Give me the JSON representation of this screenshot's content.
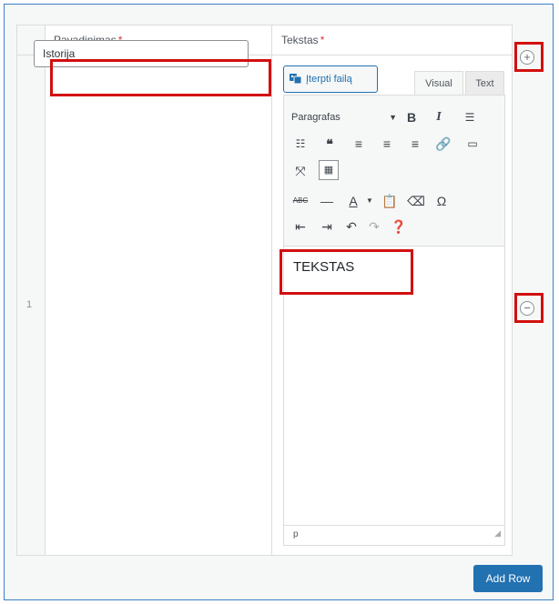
{
  "columns": {
    "title_label": "Pavadinimas",
    "text_label": "Tekstas",
    "required_mark": "*"
  },
  "row": {
    "index": "1",
    "title_value": "Istorija"
  },
  "editor": {
    "add_media_label": "Įterpti failą",
    "tabs": {
      "visual": "Visual",
      "text": "Text"
    },
    "format_select": "Paragrafas",
    "content": "TEKSTAS",
    "status_path": "p"
  },
  "actions": {
    "add_row_label": "Add Row"
  },
  "icons": {
    "add_row_inline": "plus-circle-icon",
    "remove_row": "minus-circle-icon",
    "add_media": "media-icon",
    "bold": "bold-icon",
    "italic": "italic-icon",
    "bullet_list": "bullet-list-icon",
    "numbered_list": "numbered-list-icon",
    "blockquote": "blockquote-icon",
    "align_left": "align-left-icon",
    "align_center": "align-center-icon",
    "align_right": "align-right-icon",
    "link": "link-icon",
    "read_more": "read-more-icon",
    "fullscreen": "fullscreen-icon",
    "toolbar_toggle": "toolbar-toggle-icon",
    "strikethrough": "strikethrough-icon",
    "hr": "horizontal-line-icon",
    "text_color": "text-color-icon",
    "paste_text": "paste-text-icon",
    "clear_formatting": "clear-formatting-icon",
    "special_char": "omega-icon",
    "outdent": "outdent-icon",
    "indent": "indent-icon",
    "undo": "undo-icon",
    "redo": "redo-icon",
    "help": "help-icon"
  },
  "colors": {
    "primary": "#2271b1",
    "highlight": "#d10f0f",
    "required": "#d63638"
  }
}
